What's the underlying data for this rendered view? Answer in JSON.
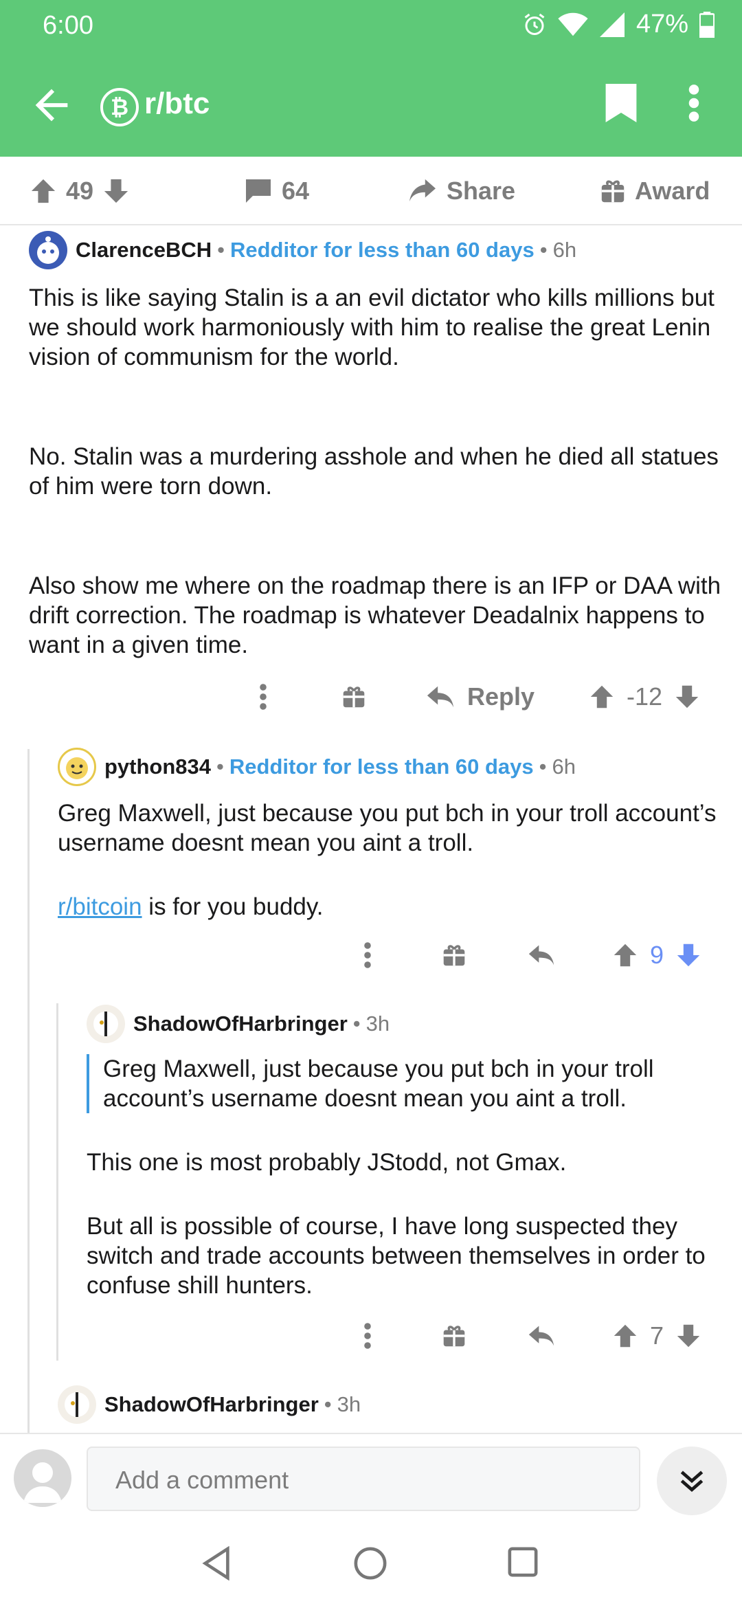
{
  "status": {
    "time": "6:00",
    "battery": "47%"
  },
  "appbar": {
    "subreddit": "r/btc",
    "sub_icon_glyph": "₿"
  },
  "post_actions": {
    "score": "49",
    "comments": "64",
    "share_label": "Share",
    "award_label": "Award"
  },
  "comments": [
    {
      "author": "ClarenceBCH",
      "flair": "Redditor for less than 60 days",
      "age": "6h",
      "paragraphs": [
        "This is like saying Stalin is a an evil dictator who kills millions but we should work harmoniously with him to realise the great Lenin vision of communism for the world.",
        "No. Stalin was a murdering asshole and when he died all statues of him were torn down.",
        "Also show me where on the roadmap there is an IFP or DAA with drift correction. The roadmap is whatever Deadalnix happens to want in a given time."
      ],
      "reply_label": "Reply",
      "score": "-12"
    },
    {
      "author": "python834",
      "flair": "Redditor for less than 60 days",
      "age": "6h",
      "paragraph1": "Greg Maxwell, just because you put bch in your troll account’s username doesnt mean you aint a troll.",
      "link_text": "r/bitcoin",
      "link_suffix": " is for you buddy.",
      "score": "9"
    },
    {
      "author": "ShadowOfHarbringer",
      "age": "3h",
      "quote": "Greg Maxwell, just because you put bch in your troll account’s username doesnt mean you aint a troll.",
      "paragraphs": [
        "This one is most probably JStodd, not Gmax.",
        "But all is possible of course, I have long suspected they switch and trade accounts between themselves in order to confuse shill hunters."
      ],
      "score": "7"
    },
    {
      "author": "ShadowOfHarbringer",
      "age": "3h"
    }
  ],
  "composer": {
    "placeholder": "Add a comment"
  },
  "colors": {
    "header_green": "#5ec978",
    "flair_blue": "#3d9be0",
    "downvote_blue": "#6a8ff5"
  },
  "icons": [
    "back-arrow-icon",
    "bitcoin-icon",
    "bookmark-icon",
    "more-vertical-icon",
    "upvote-icon",
    "downvote-icon",
    "comment-icon",
    "share-icon",
    "gift-icon",
    "reply-icon",
    "chevron-double-down-icon",
    "nav-back-icon",
    "nav-home-icon",
    "nav-recents-icon"
  ]
}
